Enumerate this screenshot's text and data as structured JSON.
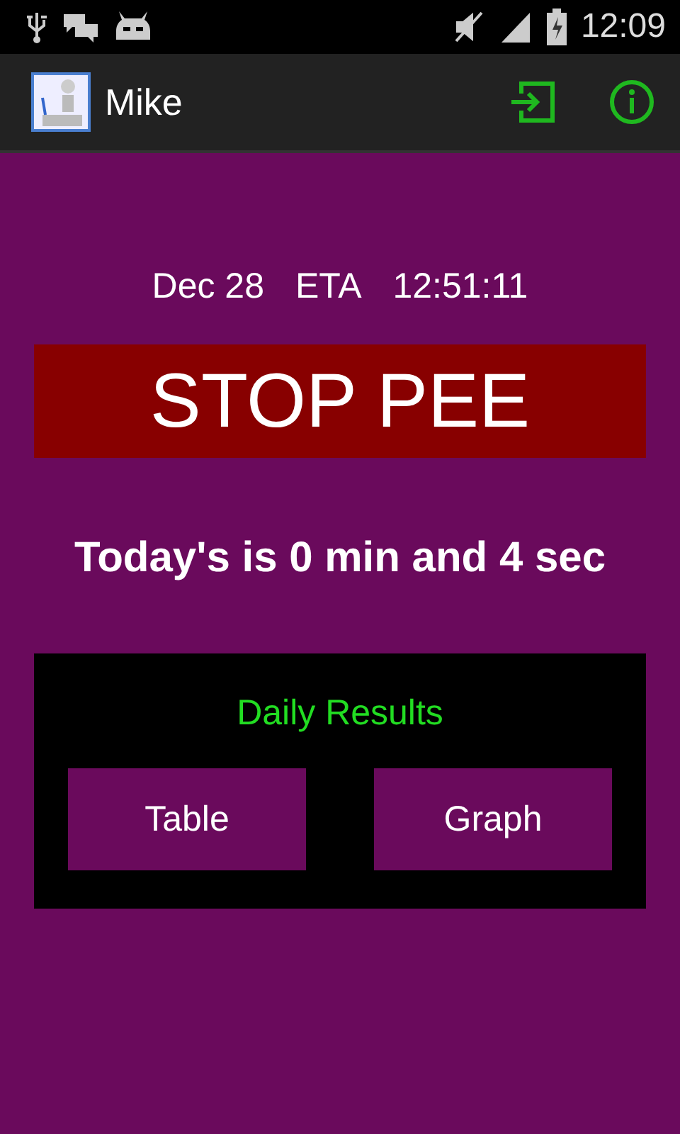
{
  "status_bar": {
    "time": "12:09"
  },
  "action_bar": {
    "title": "Mike"
  },
  "eta_line": {
    "date": "Dec 28",
    "label": "ETA",
    "time": "12:51:11"
  },
  "stop_button": {
    "label": "STOP PEE"
  },
  "today_summary": "Today's is 0 min and 4 sec",
  "daily_results": {
    "title": "Daily Results",
    "buttons": [
      "Table",
      "Graph"
    ]
  }
}
